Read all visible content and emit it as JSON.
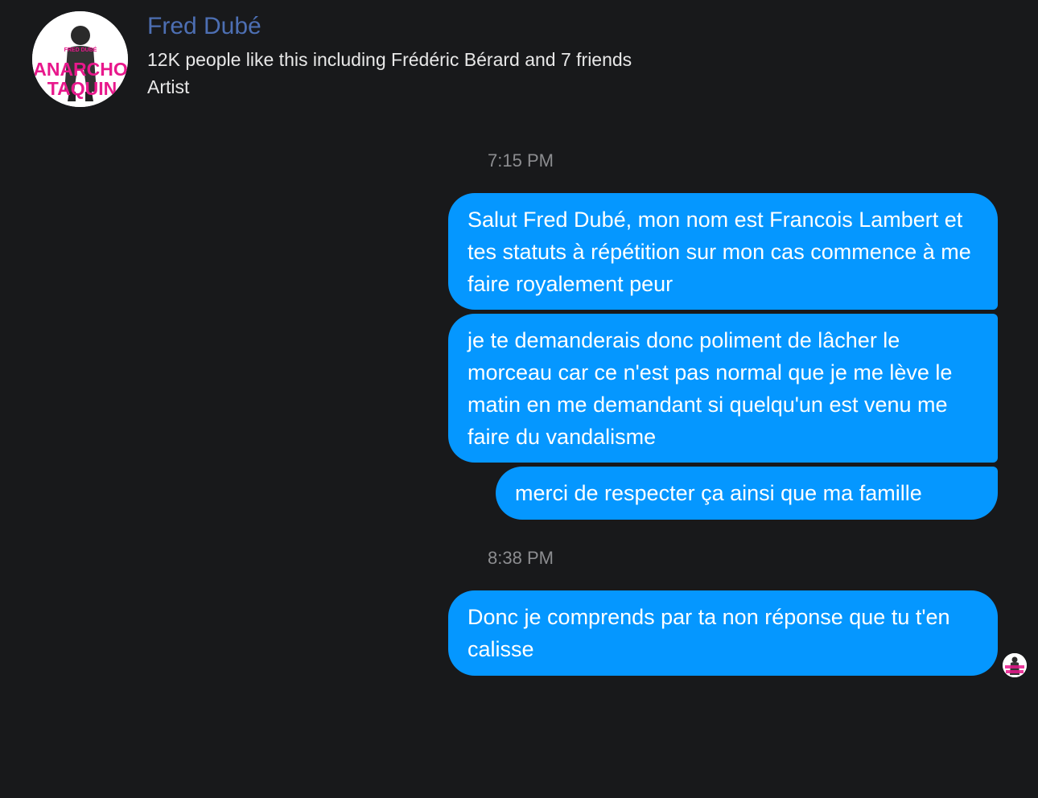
{
  "header": {
    "name": "Fred Dubé",
    "likes": "12K people like this including Frédéric Bérard and 7 friends",
    "category": "Artist",
    "avatar_text_top": "FRED DUBÉ",
    "avatar_text_line1": "ANARCHO",
    "avatar_text_line2": "TAQUIN"
  },
  "conversation": {
    "groups": [
      {
        "time": "7:15 PM",
        "messages": [
          "Salut Fred Dubé, mon nom est Francois Lambert et tes statuts à répétition sur mon cas commence à me faire royalement peur",
          "je te demanderais donc poliment de lâcher le morceau car ce n'est pas normal que je me lève le matin en me demandant si quelqu'un est venu me faire du vandalisme",
          "merci de respecter ça ainsi que ma famille"
        ]
      },
      {
        "time": "8:38 PM",
        "messages": [
          "Donc je comprends par ta non réponse que tu t'en calisse"
        ]
      }
    ]
  },
  "colors": {
    "background": "#18191b",
    "bubble": "#0597ff",
    "name": "#4d6fb3",
    "timestamp": "#8c8d90",
    "avatar_accent": "#e8188c"
  },
  "icons": {
    "profile": "page-avatar",
    "seen": "seen-avatar"
  }
}
